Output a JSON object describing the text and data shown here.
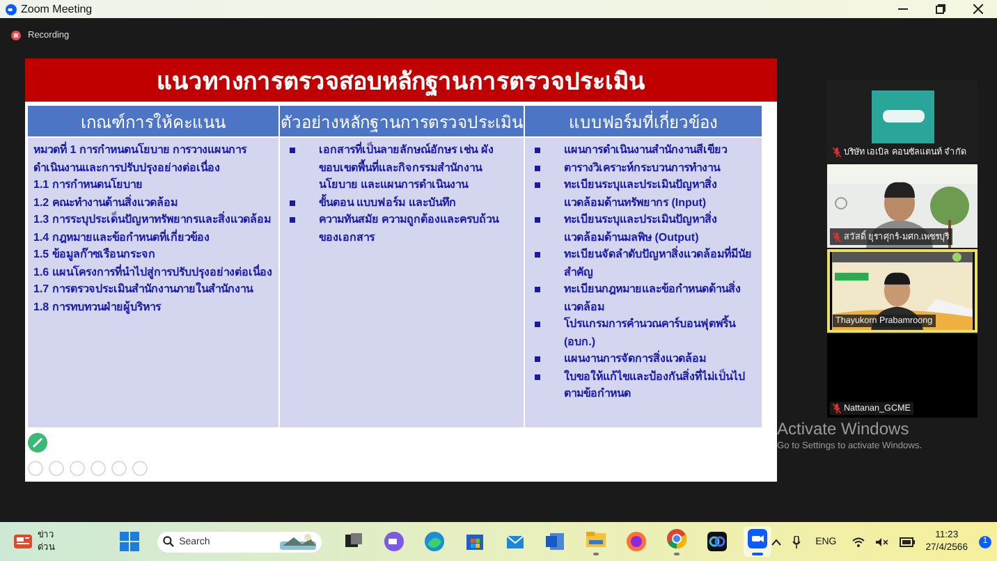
{
  "window": {
    "title": "Zoom Meeting"
  },
  "recording": {
    "label": "Recording"
  },
  "slide": {
    "title": "แนวทางการตรวจสอบหลักฐานการตรวจประเมิน",
    "columns": [
      {
        "heading": "เกณฑ์การให้คะแนน",
        "kind": "outline",
        "section": "หมวดที่ 1 การกำหนดนโยบาย การวางแผนการดำเนินงานและการปรับปรุงอย่างต่อเนื่อง",
        "items": [
          "1.1 การกำหนดนโยบาย",
          "1.2 คณะทำงานด้านสิ่งแวดล้อม",
          "1.3 การระบุประเด็นปัญหาทรัพยากรและสิ่งแวดล้อม",
          "1.4  กฎหมายและข้อกำหนดที่เกี่ยวข้อง",
          "1.5 ข้อมูลก๊าซเรือนกระจก",
          "1.6 แผนโครงการที่นำไปสู่การปรับปรุงอย่างต่อเนื่อง",
          "1.7 การตรวจประเมินสำนักงานภายในสำนักงาน",
          "1.8 การทบทวนฝ่ายผู้บริหาร"
        ]
      },
      {
        "heading": "ตัวอย่างหลักฐานการตรวจประเมิน",
        "kind": "bullet",
        "items": [
          "เอกสารที่เป็นลายลักษณ์อักษร เช่น ผังขอบเขตพื้นที่และกิจกรรมสำนักงาน นโยบาย และแผนการดำเนินงาน",
          "ขั้นตอน แบบฟอร์ม และบันทึก",
          "ความทันสมัย ความถูกต้องและครบถ้วนของเอกสาร"
        ]
      },
      {
        "heading": "แบบฟอร์มที่เกี่ยวข้อง",
        "kind": "bullet",
        "items": [
          "แผนการดำเนินงานสำนักงานสีเขียว",
          "ตารางวิเคราะห์กระบวนการทำงาน",
          "ทะเบียนระบุและประเมินปัญหาสิ่งแวดล้อมด้านทรัพยากร (Input)",
          "ทะเบียนระบุและประเมินปัญหาสิ่งแวดล้อมด้านมลพิษ (Output)",
          "ทะเบียนจัดลำดับปัญหาสิ่งแวดล้อมที่มีนัยสำคัญ",
          "ทะเบียนกฎหมายและข้อกำหนดด้านสิ่งแวดล้อม",
          "โปรแกรมการคำนวณคาร์บอนฟุตพริ้น (อบก.)",
          "แผนงานการจัดการสิ่งแวดล้อม",
          "ใบขอให้แก้ไขและป้องกันสิ่งที่ไม่เป็นไปตามข้อกำหนด"
        ]
      }
    ]
  },
  "participants": [
    {
      "name": "บริษัท เอเบิล คอนซัลแตนท์ จำกัด",
      "kind": "logo",
      "muted": true,
      "speaking": false
    },
    {
      "name": "สวัสดิ์ ยุราศุกร์-มศก.เพชรบุรี",
      "kind": "video",
      "muted": true,
      "speaking": false
    },
    {
      "name": "Thayukorn Prabamroong",
      "kind": "video",
      "muted": false,
      "speaking": true
    },
    {
      "name": "Nattanan_GCME",
      "kind": "off",
      "muted": true,
      "speaking": false
    }
  ],
  "activation_notice": {
    "title": "Activate Windows",
    "message": "Go to Settings to activate Windows."
  },
  "taskbar": {
    "news": [
      "ข่าว",
      "ด่วน"
    ],
    "search": {
      "placeholder": "Search"
    },
    "apps": [
      {
        "kind": "taskview",
        "running": false
      },
      {
        "kind": "meet",
        "running": false
      },
      {
        "kind": "edge",
        "running": false
      },
      {
        "kind": "store",
        "running": false
      },
      {
        "kind": "mail",
        "running": false
      },
      {
        "kind": "word",
        "running": false
      },
      {
        "kind": "files",
        "running": true
      },
      {
        "kind": "firefox",
        "running": false
      },
      {
        "kind": "chrome",
        "running": true
      },
      {
        "kind": "teams",
        "running": false
      },
      {
        "kind": "zoom",
        "running": true
      }
    ],
    "language": "ENG",
    "time": "11:23",
    "date": "27/4/2566",
    "notifications": "1"
  }
}
